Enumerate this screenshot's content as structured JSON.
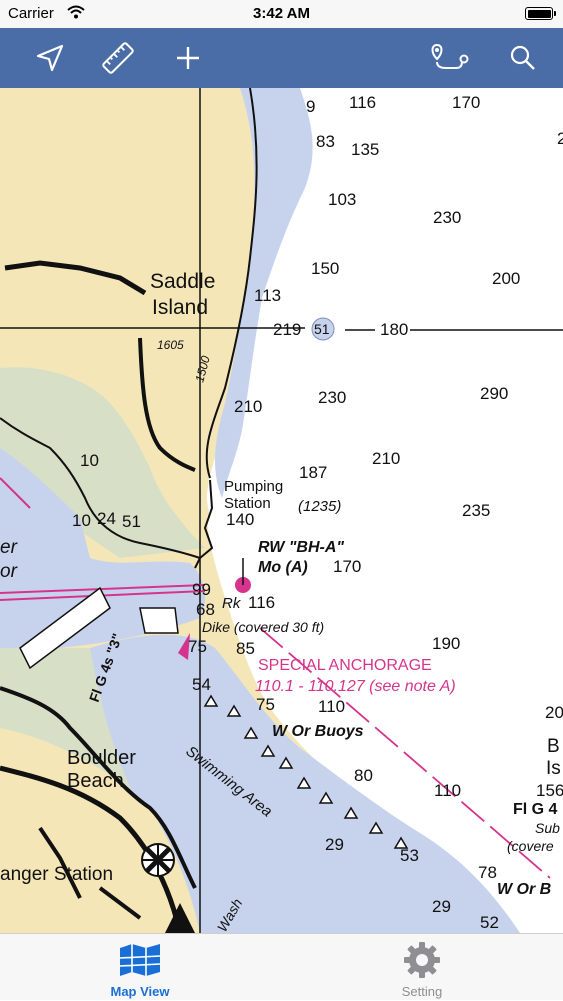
{
  "status_bar": {
    "carrier": "Carrier",
    "time": "3:42 AM"
  },
  "toolbar": {
    "icons": [
      "location-arrow-icon",
      "ruler-icon",
      "plus-icon",
      "route-icon",
      "search-icon"
    ]
  },
  "chart": {
    "colors": {
      "land": "#f5e6b8",
      "water_shallow": "#c7d3ec",
      "water_mid": "#d8dfc7",
      "water_deep": "#ffffff",
      "magenta": "#d6348c"
    },
    "place_labels": [
      {
        "id": "saddle",
        "text": "Saddle"
      },
      {
        "id": "island",
        "text": "Island"
      },
      {
        "id": "boulder",
        "text": "Boulder"
      },
      {
        "id": "beach",
        "text": "Beach"
      },
      {
        "id": "ranger",
        "text": "anger Station"
      },
      {
        "id": "pumping",
        "text": "Pumping"
      },
      {
        "id": "station",
        "text": "Station"
      },
      {
        "id": "rw",
        "text": "RW \"BH-A\""
      },
      {
        "id": "mo",
        "text": "Mo (A)"
      },
      {
        "id": "rk",
        "text": "Rk"
      },
      {
        "id": "dike",
        "text": "Dike (covered 30 ft)"
      },
      {
        "id": "special",
        "text": "SPECIAL   ANCHORAGE"
      },
      {
        "id": "range",
        "text": "110.1 - 110.127 (see note A)"
      },
      {
        "id": "buoys",
        "text": "W Or Buoys"
      },
      {
        "id": "swimming",
        "text": "Swimming Area"
      },
      {
        "id": "light",
        "text": "Fl G 4s \"3\""
      },
      {
        "id": "er",
        "text": "er"
      },
      {
        "id": "or",
        "text": "or"
      },
      {
        "id": "b",
        "text": "B"
      },
      {
        "id": "is",
        "text": "Is"
      },
      {
        "id": "flg4",
        "text": "Fl G 4"
      },
      {
        "id": "sub",
        "text": "Sub"
      },
      {
        "id": "covered",
        "text": "(covere"
      },
      {
        "id": "wor",
        "text": "W Or B"
      },
      {
        "id": "h1235",
        "text": "(1235)"
      },
      {
        "id": "wash",
        "text": "Wash"
      },
      {
        "id": "h1605",
        "text": "1605"
      },
      {
        "id": "h1500",
        "text": "1500"
      },
      {
        "id": "c51",
        "text": "51"
      }
    ],
    "soundings": [
      {
        "id": "s1",
        "text": "9"
      },
      {
        "id": "s2",
        "text": "116"
      },
      {
        "id": "s3",
        "text": "170"
      },
      {
        "id": "s4",
        "text": "83"
      },
      {
        "id": "s5",
        "text": "135"
      },
      {
        "id": "s6",
        "text": "103"
      },
      {
        "id": "s7",
        "text": "230"
      },
      {
        "id": "s8",
        "text": "150"
      },
      {
        "id": "s9",
        "text": "200"
      },
      {
        "id": "s10",
        "text": "113"
      },
      {
        "id": "s11",
        "text": "219"
      },
      {
        "id": "s12",
        "text": "180"
      },
      {
        "id": "s13",
        "text": "290"
      },
      {
        "id": "s14",
        "text": "230"
      },
      {
        "id": "s15",
        "text": "210"
      },
      {
        "id": "s16",
        "text": "210"
      },
      {
        "id": "s17",
        "text": "187"
      },
      {
        "id": "s18",
        "text": "10"
      },
      {
        "id": "s19",
        "text": "10"
      },
      {
        "id": "s20",
        "text": "24"
      },
      {
        "id": "s21",
        "text": "51"
      },
      {
        "id": "s22",
        "text": "140"
      },
      {
        "id": "s23",
        "text": "235"
      },
      {
        "id": "s24",
        "text": "170"
      },
      {
        "id": "s25",
        "text": "99"
      },
      {
        "id": "s26",
        "text": "68"
      },
      {
        "id": "s27",
        "text": "116"
      },
      {
        "id": "s28",
        "text": "190"
      },
      {
        "id": "s29",
        "text": "75"
      },
      {
        "id": "s30",
        "text": "85"
      },
      {
        "id": "s31",
        "text": "54"
      },
      {
        "id": "s32",
        "text": "110"
      },
      {
        "id": "s33",
        "text": "75"
      },
      {
        "id": "s34",
        "text": "20"
      },
      {
        "id": "s35",
        "text": "80"
      },
      {
        "id": "s36",
        "text": "110"
      },
      {
        "id": "s37",
        "text": "156"
      },
      {
        "id": "s38",
        "text": "29"
      },
      {
        "id": "s39",
        "text": "53"
      },
      {
        "id": "s40",
        "text": "78"
      },
      {
        "id": "s41",
        "text": "29"
      },
      {
        "id": "s42",
        "text": "52"
      },
      {
        "id": "s43",
        "text": "2"
      }
    ]
  },
  "tab_bar": {
    "tabs": [
      {
        "label": "Map View",
        "icon": "map-icon",
        "active": true
      },
      {
        "label": "Setting",
        "icon": "gear-icon",
        "active": false
      }
    ]
  }
}
